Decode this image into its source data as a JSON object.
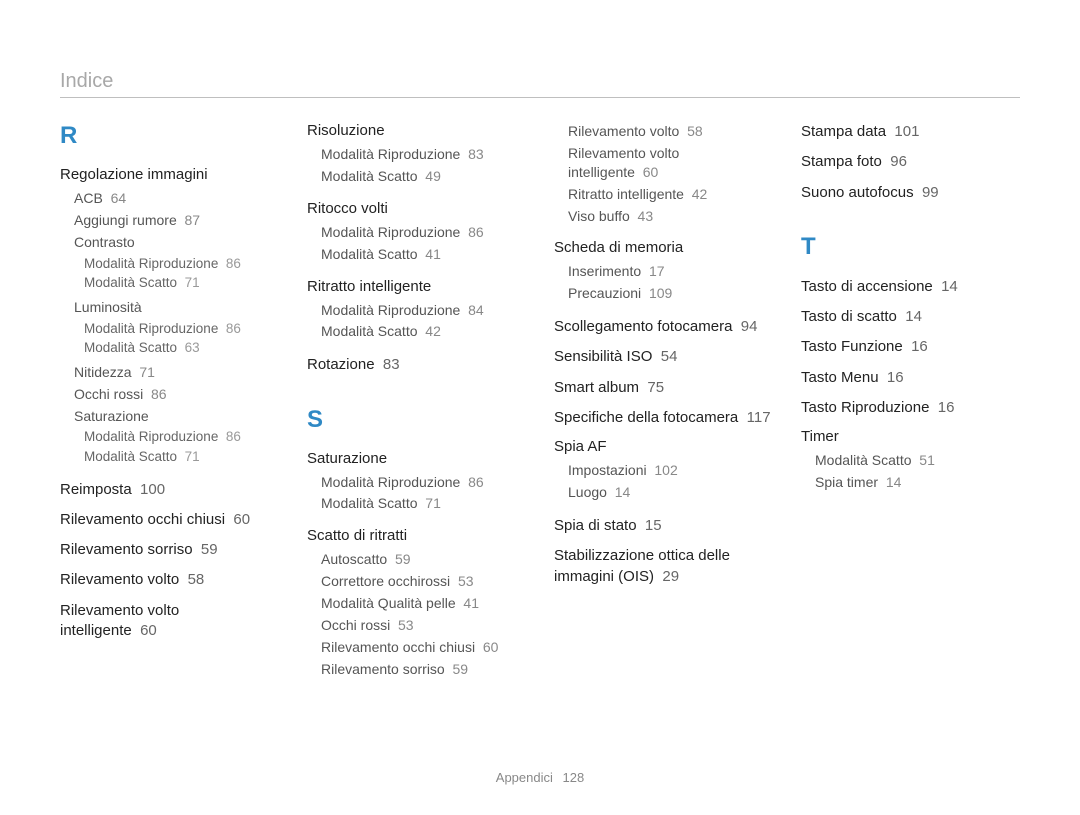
{
  "header": {
    "title": "Indice"
  },
  "footer": {
    "label": "Appendici",
    "page": "128"
  },
  "letters": {
    "R": "R",
    "S": "S",
    "T": "T"
  },
  "col1": {
    "regolazione_immagini": {
      "title": "Regolazione immagini",
      "acb": {
        "label": "ACB",
        "pg": "64"
      },
      "aggiungi_rumore": {
        "label": "Aggiungi rumore",
        "pg": "87"
      },
      "contrasto": {
        "label": "Contrasto",
        "riproduzione": {
          "label": "Modalità Riproduzione",
          "pg": "86"
        },
        "scatto": {
          "label": "Modalità Scatto",
          "pg": "71"
        }
      },
      "luminosita": {
        "label": "Luminosità",
        "riproduzione": {
          "label": "Modalità Riproduzione",
          "pg": "86"
        },
        "scatto": {
          "label": "Modalità Scatto",
          "pg": "63"
        }
      },
      "nitidezza": {
        "label": "Nitidezza",
        "pg": "71"
      },
      "occhi_rossi": {
        "label": "Occhi rossi",
        "pg": "86"
      },
      "saturazione": {
        "label": "Saturazione",
        "riproduzione": {
          "label": "Modalità Riproduzione",
          "pg": "86"
        },
        "scatto": {
          "label": "Modalità Scatto",
          "pg": "71"
        }
      }
    },
    "reimposta": {
      "label": "Reimposta",
      "pg": "100"
    },
    "rilevamento_occhi_chiusi": {
      "label": "Rilevamento occhi chiusi",
      "pg": "60"
    },
    "rilevamento_sorriso": {
      "label": "Rilevamento sorriso",
      "pg": "59"
    },
    "rilevamento_volto": {
      "label": "Rilevamento volto",
      "pg": "58"
    },
    "rilevamento_volto_intelligente": {
      "label": "Rilevamento volto intelligente",
      "pg": "60"
    }
  },
  "col2": {
    "risoluzione": {
      "title": "Risoluzione",
      "riproduzione": {
        "label": "Modalità Riproduzione",
        "pg": "83"
      },
      "scatto": {
        "label": "Modalità Scatto",
        "pg": "49"
      }
    },
    "ritocco_volti": {
      "title": "Ritocco volti",
      "riproduzione": {
        "label": "Modalità Riproduzione",
        "pg": "86"
      },
      "scatto": {
        "label": "Modalità Scatto",
        "pg": "41"
      }
    },
    "ritratto_intelligente": {
      "title": "Ritratto intelligente",
      "riproduzione": {
        "label": "Modalità Riproduzione",
        "pg": "84"
      },
      "scatto": {
        "label": "Modalità Scatto",
        "pg": "42"
      }
    },
    "rotazione": {
      "label": "Rotazione",
      "pg": "83"
    },
    "saturazione": {
      "title": "Saturazione",
      "riproduzione": {
        "label": "Modalità Riproduzione",
        "pg": "86"
      },
      "scatto": {
        "label": "Modalità Scatto",
        "pg": "71"
      }
    },
    "scatto_di_ritratti": {
      "title": "Scatto di ritratti",
      "autoscatto": {
        "label": "Autoscatto",
        "pg": "59"
      },
      "correttore": {
        "label": "Correttore occhirossi",
        "pg": "53"
      },
      "qualita_pelle": {
        "label": "Modalità Qualità pelle",
        "pg": "41"
      },
      "occhi_rossi": {
        "label": "Occhi rossi",
        "pg": "53"
      },
      "occhi_chiusi": {
        "label": "Rilevamento occhi chiusi",
        "pg": "60"
      },
      "sorriso": {
        "label": "Rilevamento sorriso",
        "pg": "59"
      }
    }
  },
  "col3": {
    "scatto_di_ritratti_cont": {
      "rilevamento_volto": {
        "label": "Rilevamento volto",
        "pg": "58"
      },
      "rvi": {
        "label": "Rilevamento volto intelligente",
        "pg": "60"
      },
      "ritratto_int": {
        "label": "Ritratto intelligente",
        "pg": "42"
      },
      "viso_buffo": {
        "label": "Viso buffo",
        "pg": "43"
      }
    },
    "scheda_memoria": {
      "title": "Scheda di memoria",
      "inserimento": {
        "label": "Inserimento",
        "pg": "17"
      },
      "precauzioni": {
        "label": "Precauzioni",
        "pg": "109"
      }
    },
    "scollegamento": {
      "label": "Scollegamento fotocamera",
      "pg": "94"
    },
    "sensibilita_iso": {
      "label": "Sensibilità ISO",
      "pg": "54"
    },
    "smart_album": {
      "label": "Smart album",
      "pg": "75"
    },
    "specifiche": {
      "label": "Specifiche della fotocamera",
      "pg": "117"
    },
    "spia_af": {
      "title": "Spia AF",
      "impostazioni": {
        "label": "Impostazioni",
        "pg": "102"
      },
      "luogo": {
        "label": "Luogo",
        "pg": "14"
      }
    },
    "spia_di_stato": {
      "label": "Spia di stato",
      "pg": "15"
    },
    "ois": {
      "label": "Stabilizzazione ottica delle immagini (OIS)",
      "pg": "29"
    }
  },
  "col4": {
    "stampa_data": {
      "label": "Stampa data",
      "pg": "101"
    },
    "stampa_foto": {
      "label": "Stampa foto",
      "pg": "96"
    },
    "suono_autofocus": {
      "label": "Suono autofocus",
      "pg": "99"
    },
    "tasto_accensione": {
      "label": "Tasto di accensione",
      "pg": "14"
    },
    "tasto_scatto": {
      "label": "Tasto di scatto",
      "pg": "14"
    },
    "tasto_funzione": {
      "label": "Tasto Funzione",
      "pg": "16"
    },
    "tasto_menu": {
      "label": "Tasto Menu",
      "pg": "16"
    },
    "tasto_riproduzione": {
      "label": "Tasto Riproduzione",
      "pg": "16"
    },
    "timer": {
      "title": "Timer",
      "scatto": {
        "label": "Modalità Scatto",
        "pg": "51"
      },
      "spia": {
        "label": "Spia timer",
        "pg": "14"
      }
    }
  }
}
